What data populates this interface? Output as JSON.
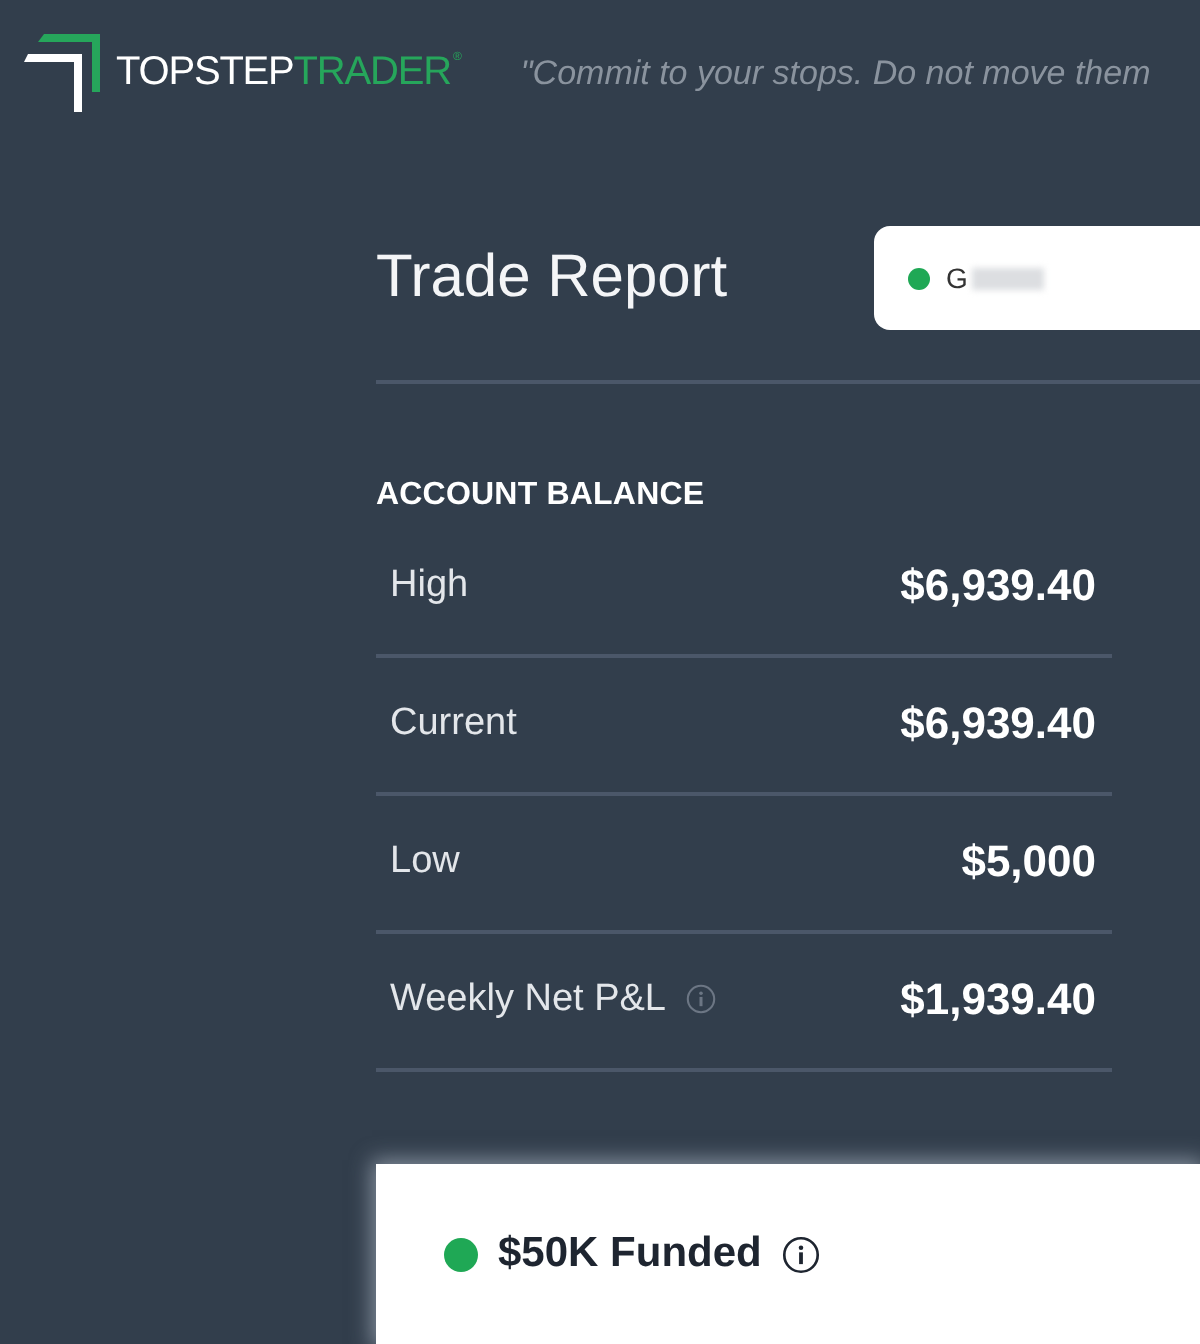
{
  "header": {
    "logo": {
      "primary": "TOPSTEP",
      "secondary": "TRADER",
      "mark": "®"
    },
    "tagline": "\"Commit to your stops. Do not move them"
  },
  "report": {
    "title": "Trade Report",
    "account_select": {
      "value": "G",
      "color": "#1fa855",
      "redacted": true
    }
  },
  "account_balance": {
    "heading": "ACCOUNT BALANCE",
    "rows": [
      {
        "label": "High",
        "value": "$6,939.40",
        "info": false
      },
      {
        "label": "Current",
        "value": "$6,939.40",
        "info": false
      },
      {
        "label": "Low",
        "value": "$5,000",
        "info": false
      },
      {
        "label": "Weekly Net P&L",
        "value": "$1,939.40",
        "info": true
      }
    ]
  },
  "account_card": {
    "title": "$50K Funded",
    "color": "#1fa855",
    "info": true
  }
}
